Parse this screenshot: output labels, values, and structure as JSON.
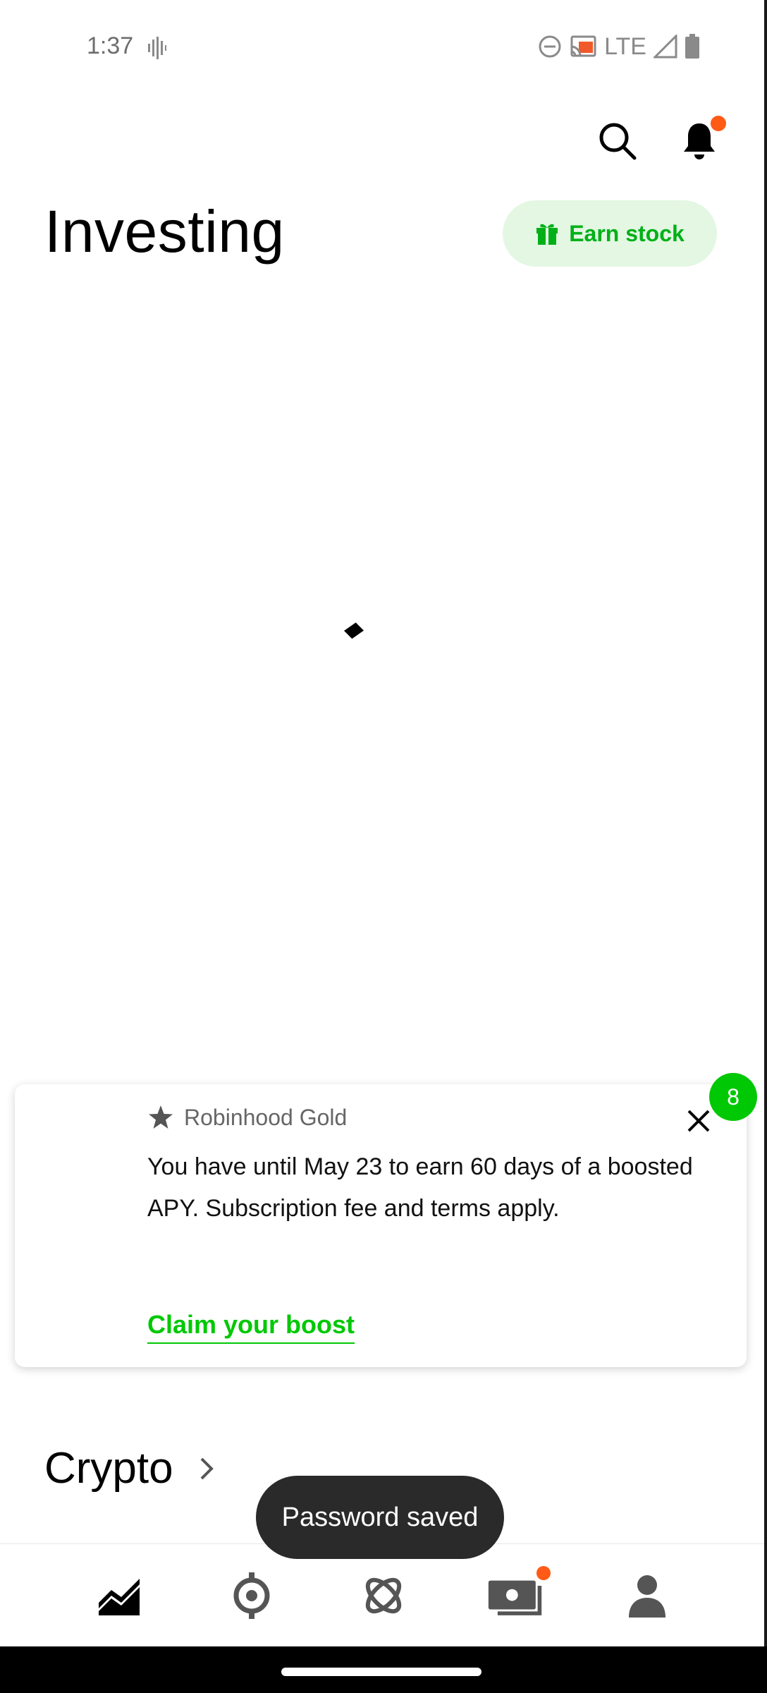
{
  "status_bar": {
    "time": "1:37",
    "network": "LTE"
  },
  "header": {
    "title": "Investing",
    "earn_button": "Earn stock"
  },
  "card": {
    "badge": "8",
    "brand": "Robinhood Gold",
    "body": "You have until May 23 to earn 60 days of a boosted APY. Subscription fee and terms apply.",
    "link": "Claim your boost"
  },
  "sections": {
    "crypto": "Crypto"
  },
  "toast": {
    "message": "Password saved"
  },
  "colors": {
    "accent_green": "#00c805",
    "notification_orange": "#ff5a16",
    "earn_bg": "#e3f7e3"
  },
  "bottom_nav": {
    "items": [
      {
        "icon": "investing-chart-icon"
      },
      {
        "icon": "discover-icon"
      },
      {
        "icon": "crypto-icon"
      },
      {
        "icon": "cash-card-icon"
      },
      {
        "icon": "account-person-icon"
      }
    ]
  }
}
